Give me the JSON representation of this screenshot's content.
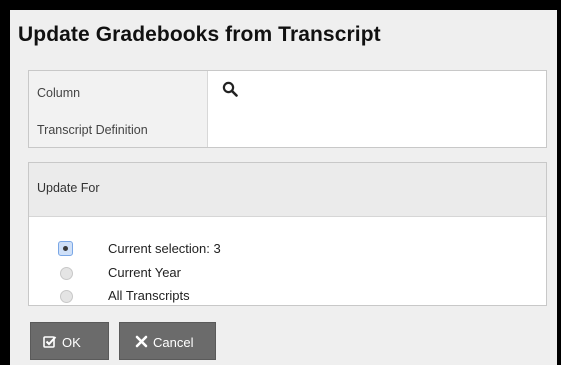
{
  "dialog": {
    "title": "Update Gradebooks from Transcript"
  },
  "column_field": {
    "label": "Column",
    "sublabel": "Transcript Definition",
    "icon": "search-icon"
  },
  "update_for": {
    "header": "Update For",
    "options": [
      {
        "label": "Current selection: 3",
        "selected": true
      },
      {
        "label": "Current Year",
        "selected": false
      },
      {
        "label": "All Transcripts",
        "selected": false
      }
    ]
  },
  "buttons": {
    "ok_label": "OK",
    "ok_icon": "check-square-icon",
    "cancel_label": "Cancel",
    "cancel_icon": "close-icon"
  }
}
